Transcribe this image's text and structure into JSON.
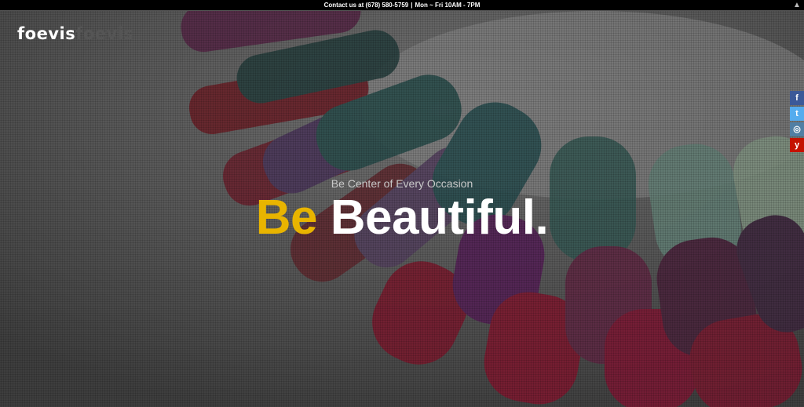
{
  "topbar": {
    "contact": "Contact us at (678) 580-5759",
    "separator": "|",
    "hours": "Mon ~ Fri  10AM - 7PM",
    "scroll_icon": "arrow-up-icon"
  },
  "logo": {
    "part1": "foevis",
    "part2": "foevis"
  },
  "hero": {
    "tagline": "Be Center of Every Occasion",
    "headline_accent": "Be",
    "headline_main": "Beautiful.",
    "accent_color": "#e8b400"
  },
  "social": [
    {
      "icon": "facebook-icon",
      "glyph": "f",
      "color": "#3b5998"
    },
    {
      "icon": "twitter-icon",
      "glyph": "t",
      "color": "#55acee"
    },
    {
      "icon": "instagram-icon",
      "glyph": "◎",
      "color": "#517fa4"
    },
    {
      "icon": "yelp-icon",
      "glyph": "y",
      "color": "#c41200"
    }
  ]
}
